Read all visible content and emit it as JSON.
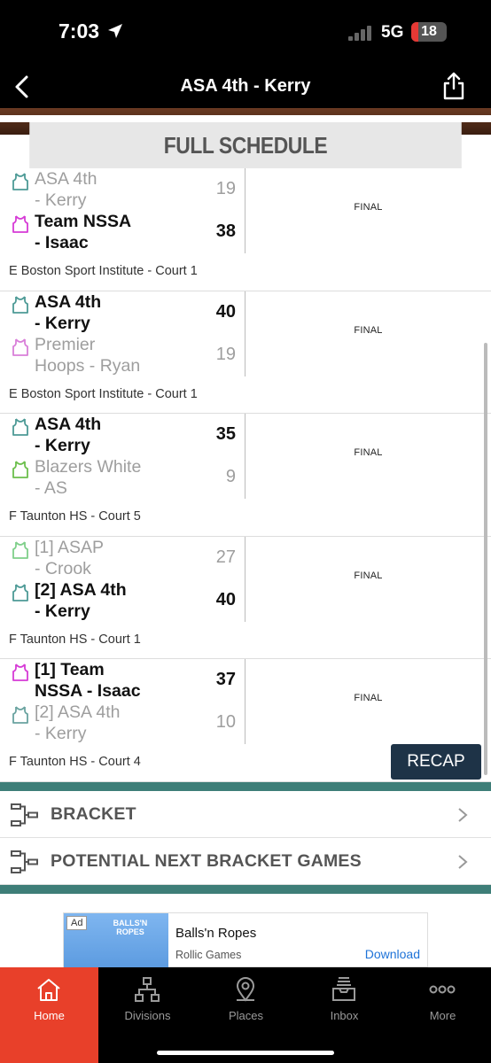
{
  "status_bar": {
    "time": "7:03",
    "network": "5G",
    "battery": "18"
  },
  "nav": {
    "title": "ASA 4th - Kerry"
  },
  "section_title": "FULL SCHEDULE",
  "games": [
    {
      "team1": {
        "name": "ASA 4th\n- Kerry",
        "score": "19",
        "winner": false,
        "jersey_color": "#4d9a96"
      },
      "team2": {
        "name": "Team NSSA\n- Isaac",
        "score": "38",
        "winner": true,
        "jersey_color": "#d63bd6"
      },
      "status": "FINAL",
      "location": "E Boston Sport Institute - Court 1"
    },
    {
      "team1": {
        "name": "ASA 4th\n- Kerry",
        "score": "40",
        "winner": true,
        "jersey_color": "#4d9a96"
      },
      "team2": {
        "name": "Premier\nHoops - Ryan",
        "score": "19",
        "winner": false,
        "jersey_color": "#d97fd9"
      },
      "status": "FINAL",
      "location": "E Boston Sport Institute - Court 1"
    },
    {
      "team1": {
        "name": "ASA 4th\n- Kerry",
        "score": "35",
        "winner": true,
        "jersey_color": "#4d9a96"
      },
      "team2": {
        "name": "Blazers White\n- AS",
        "score": "9",
        "winner": false,
        "jersey_color": "#6cbf4c"
      },
      "status": "FINAL",
      "location": "F Taunton HS - Court 5"
    },
    {
      "team1": {
        "name": "[1] ASAP\n- Crook",
        "score": "27",
        "winner": false,
        "jersey_color": "#7fcf8a"
      },
      "team2": {
        "name": "[2] ASA 4th\n- Kerry",
        "score": "40",
        "winner": true,
        "jersey_color": "#4d9a96"
      },
      "status": "FINAL",
      "location": "F Taunton HS - Court 1"
    },
    {
      "team1": {
        "name": "[1] Team\nNSSA - Isaac",
        "score": "37",
        "winner": true,
        "jersey_color": "#d63bd6"
      },
      "team2": {
        "name": "[2] ASA 4th\n- Kerry",
        "score": "10",
        "winner": false,
        "jersey_color": "#6aa3a0"
      },
      "status": "FINAL",
      "location": "F Taunton HS - Court 4",
      "recap_label": "RECAP"
    }
  ],
  "links": {
    "bracket": "BRACKET",
    "potential": "POTENTIAL NEXT BRACKET GAMES"
  },
  "ad": {
    "badge": "Ad",
    "thumb_title": "BALLS'N ROPES",
    "title": "Balls'n Ropes",
    "publisher": "Rollic Games",
    "cta": "Download"
  },
  "tabs": [
    {
      "label": "Home",
      "icon": "home-icon",
      "active": true
    },
    {
      "label": "Divisions",
      "icon": "divisions-icon",
      "active": false
    },
    {
      "label": "Places",
      "icon": "places-icon",
      "active": false
    },
    {
      "label": "Inbox",
      "icon": "inbox-icon",
      "active": false
    },
    {
      "label": "More",
      "icon": "more-icon",
      "active": false
    }
  ]
}
